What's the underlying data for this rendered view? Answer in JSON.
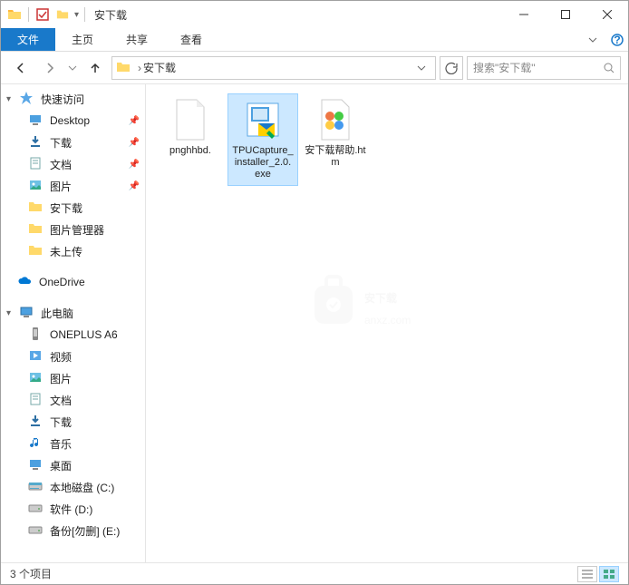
{
  "title": "安下载",
  "ribbon": {
    "tabs": [
      "文件",
      "主页",
      "共享",
      "查看"
    ]
  },
  "breadcrumb": {
    "path": "安下载"
  },
  "search": {
    "placeholder": "搜索\"安下载\""
  },
  "sidebar": {
    "quickaccess": {
      "label": "快速访问"
    },
    "items": [
      {
        "label": "Desktop",
        "icon": "desktop",
        "pinned": true,
        "indent": 1
      },
      {
        "label": "下载",
        "icon": "downloads",
        "pinned": true,
        "indent": 1
      },
      {
        "label": "文档",
        "icon": "documents",
        "pinned": true,
        "indent": 1
      },
      {
        "label": "图片",
        "icon": "pictures",
        "pinned": true,
        "indent": 1
      },
      {
        "label": "安下载",
        "icon": "folder",
        "pinned": false,
        "indent": 1
      },
      {
        "label": "图片管理器",
        "icon": "folder",
        "pinned": false,
        "indent": 1
      },
      {
        "label": "未上传",
        "icon": "folder",
        "pinned": false,
        "indent": 1
      }
    ],
    "onedrive": {
      "label": "OneDrive"
    },
    "thispc": {
      "label": "此电脑"
    },
    "pcitems": [
      {
        "label": "ONEPLUS A6",
        "icon": "device"
      },
      {
        "label": "视频",
        "icon": "videos"
      },
      {
        "label": "图片",
        "icon": "pictures"
      },
      {
        "label": "文档",
        "icon": "documents"
      },
      {
        "label": "下载",
        "icon": "downloads"
      },
      {
        "label": "音乐",
        "icon": "music"
      },
      {
        "label": "桌面",
        "icon": "desktop"
      },
      {
        "label": "本地磁盘 (C:)",
        "icon": "drive-c"
      },
      {
        "label": "软件 (D:)",
        "icon": "drive"
      },
      {
        "label": "备份[勿删] (E:)",
        "icon": "drive"
      }
    ]
  },
  "files": [
    {
      "name": "pnghhbd.",
      "icon": "blank",
      "selected": false
    },
    {
      "name": "TPUCapture_installer_2.0.exe",
      "icon": "installer",
      "selected": true
    },
    {
      "name": "安下载帮助.htm",
      "icon": "htm",
      "selected": false
    }
  ],
  "statusbar": {
    "text": "3 个项目"
  },
  "watermark": {
    "line1": "安下载",
    "line2": "anxz.com"
  }
}
